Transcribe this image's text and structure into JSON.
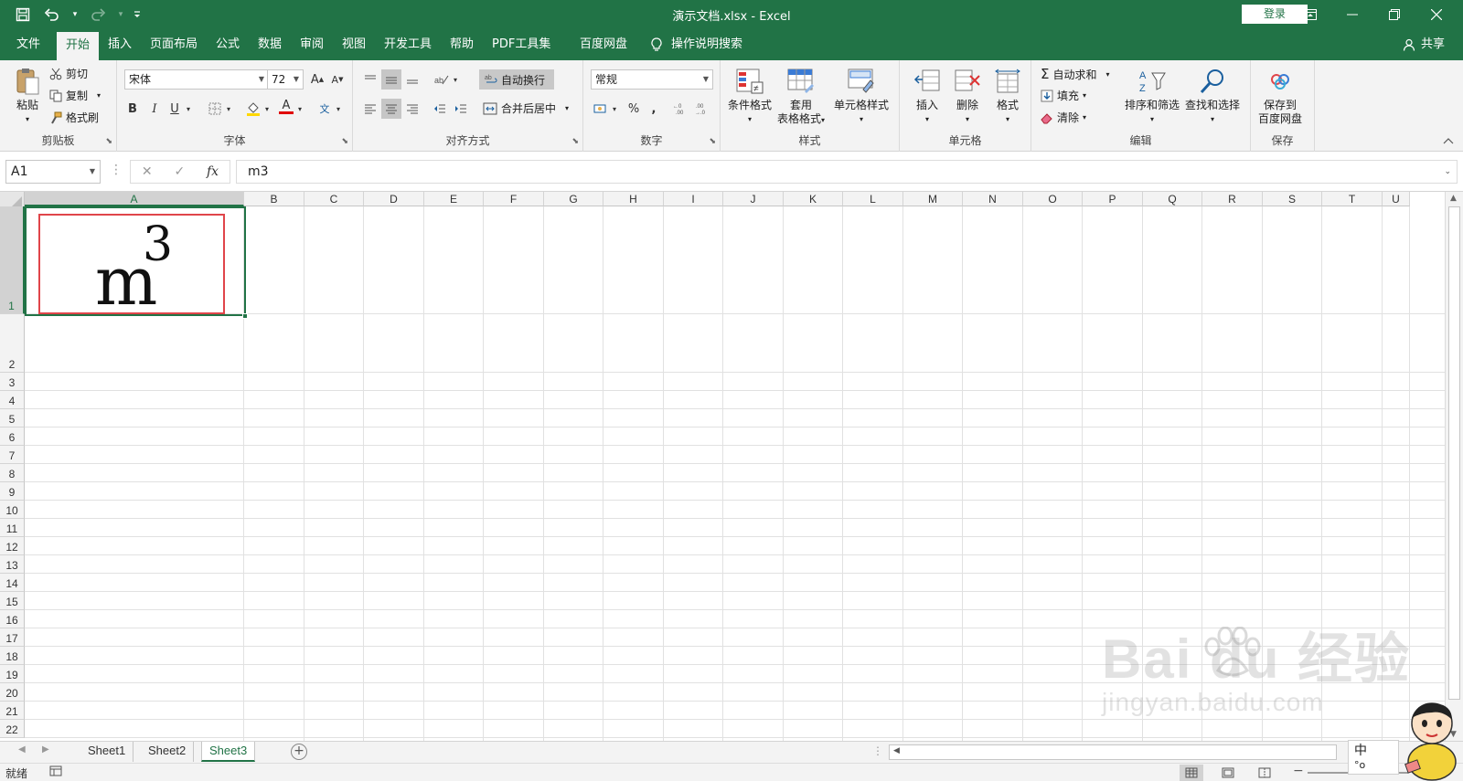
{
  "titlebar": {
    "title": "演示文档.xlsx  -  Excel",
    "login_label": "登录",
    "qat": [
      "save-icon",
      "undo-icon",
      "redo-icon",
      "customize-icon"
    ]
  },
  "menu": {
    "tabs": [
      "文件",
      "开始",
      "插入",
      "页面布局",
      "公式",
      "数据",
      "审阅",
      "视图",
      "开发工具",
      "帮助",
      "PDF工具集",
      "百度网盘"
    ],
    "active_tab": "开始",
    "tell_me": "操作说明搜索",
    "share": "共享"
  },
  "ribbon": {
    "clipboard": {
      "label": "剪贴板",
      "paste": "粘贴",
      "cut": "剪切",
      "copy": "复制",
      "format_painter": "格式刷"
    },
    "font": {
      "label": "字体",
      "font_name": "宋体",
      "font_size": "72",
      "bold": "B",
      "italic": "I",
      "underline": "U",
      "grow": "A",
      "shrink": "A",
      "font_color": "A",
      "phonetic": "文"
    },
    "alignment": {
      "label": "对齐方式",
      "wrap_text": "自动换行",
      "merge_center": "合并后居中"
    },
    "number": {
      "label": "数字",
      "format": "常规",
      "percent": "%",
      "comma": ","
    },
    "styles": {
      "label": "样式",
      "conditional": "条件格式",
      "table_format_line1": "套用",
      "table_format_line2": "表格格式",
      "cell_styles": "单元格样式"
    },
    "cells": {
      "label": "单元格",
      "insert": "插入",
      "delete": "删除",
      "format": "格式"
    },
    "editing": {
      "label": "编辑",
      "autosum": "自动求和",
      "fill": "填充",
      "clear": "清除",
      "sort_filter": "排序和筛选",
      "find_select": "查找和选择"
    },
    "save": {
      "label": "保存",
      "save_line1": "保存到",
      "save_line2": "百度网盘"
    }
  },
  "formula_bar": {
    "name_box": "A1",
    "fx": "fx",
    "cancel": "✕",
    "enter": "✓",
    "content": "m3"
  },
  "grid": {
    "columns": [
      "A",
      "B",
      "C",
      "D",
      "E",
      "F",
      "G",
      "H",
      "I",
      "J",
      "K",
      "L",
      "M",
      "N",
      "O",
      "P",
      "Q",
      "R",
      "S",
      "T",
      "U"
    ],
    "rows": [
      "1",
      "2",
      "3",
      "4",
      "5",
      "6",
      "7",
      "8",
      "9",
      "10",
      "11",
      "12",
      "13",
      "14",
      "15",
      "16",
      "17",
      "18",
      "19",
      "20",
      "21",
      "22"
    ],
    "selected_cell": "A1",
    "cell_a1": {
      "base": "m",
      "superscript": "3"
    }
  },
  "sheets": {
    "tabs": [
      "Sheet1",
      "Sheet2",
      "Sheet3"
    ],
    "active": "Sheet3"
  },
  "statusbar": {
    "ready": "就绪"
  },
  "overlay": {
    "watermark_brand": "Bai du 经验",
    "watermark_url": "jingyan.baidu.com",
    "ime_label": "中",
    "ime_sub": "°o"
  },
  "colors": {
    "excel_green": "#217346",
    "ribbon_bg": "#f3f3f3",
    "highlight_red": "#e0454a"
  }
}
